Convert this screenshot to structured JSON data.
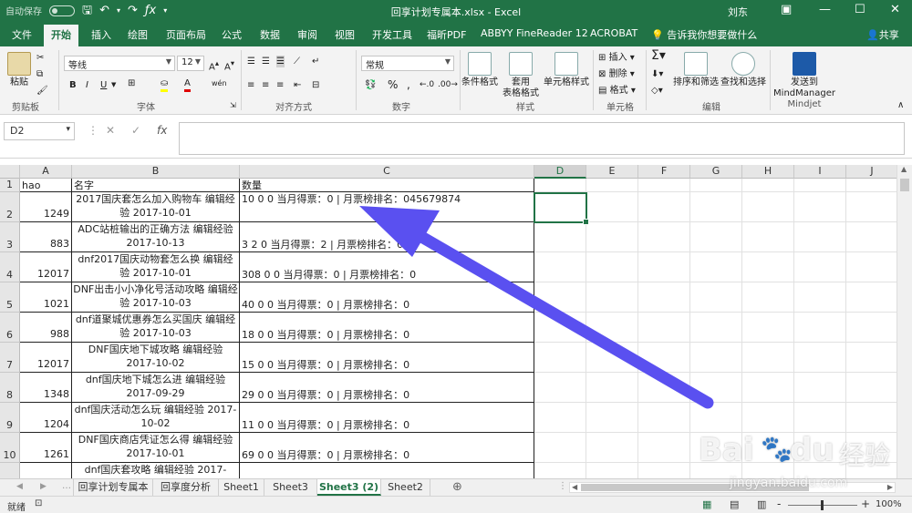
{
  "window": {
    "title": "回享计划专属本.xlsx - Excel",
    "autosave_label": "自动保存",
    "autosave_state": "关",
    "user": "刘东",
    "share_label": "共享"
  },
  "tabs": [
    "文件",
    "开始",
    "插入",
    "绘图",
    "页面布局",
    "公式",
    "数据",
    "审阅",
    "视图",
    "开发工具",
    "福昕PDF",
    "ABBYY FineReader 12",
    "ACROBAT"
  ],
  "active_tab": "开始",
  "tell_me": "告诉我你想要做什么",
  "ribbon": {
    "paste_label": "粘贴",
    "clipboard_label": "剪贴板",
    "font_name": "等线",
    "font_size": "12",
    "font_label": "字体",
    "bold": "B",
    "italic": "I",
    "underline": "U",
    "wen": "wén",
    "align_label": "对齐方式",
    "number_format": "常规",
    "number_label": "数字",
    "percent": "%",
    "comma": ",",
    "cond_format": "条件格式",
    "table_format_1": "套用",
    "table_format_2": "表格格式",
    "cell_style": "单元格样式",
    "styles_label": "样式",
    "insert": "插入",
    "delete": "删除",
    "format": "格式",
    "cells_label": "单元格",
    "sort_filter": "排序和筛选",
    "find_select": "查找和选择",
    "editing_label": "编辑",
    "mindmanager_1": "发送到",
    "mindmanager_2": "MindManager",
    "mindjet_label": "Mindjet"
  },
  "name_box": "D2",
  "formula_bar": {
    "fx": "fx",
    "value": ""
  },
  "columns": [
    "A",
    "B",
    "C",
    "D",
    "E",
    "F",
    "G",
    "H",
    "I",
    "J"
  ],
  "selected_column": "D",
  "rows": [
    {
      "n": "1",
      "a": "hao",
      "b": "名字",
      "c": "数量"
    },
    {
      "n": "2",
      "a": "1249",
      "b": "2017国庆套怎么加入购物车 编辑经验 2017-10-01",
      "c": "10 0 0 当月得票：0 | 月票榜排名：045679874"
    },
    {
      "n": "3",
      "a": "883",
      "b": "ADC站桩输出的正确方法 编辑经验 2017-10-13",
      "c": "3 2 0 当月得票：2 | 月票榜排名：0"
    },
    {
      "n": "4",
      "a": "12017",
      "b": "dnf2017国庆动物套怎么换 编辑经验 2017-10-01",
      "c": "308 0 0 当月得票：0 | 月票榜排名：0"
    },
    {
      "n": "5",
      "a": "1021",
      "b": "DNF出击小小净化号活动攻略 编辑经验 2017-10-03",
      "c": "40 0 0 当月得票：0 | 月票榜排名：0"
    },
    {
      "n": "6",
      "a": "988",
      "b": "dnf道聚城优惠券怎么买国庆 编辑经验 2017-10-03",
      "c": "18 0 0 当月得票：0 | 月票榜排名：0"
    },
    {
      "n": "7",
      "a": "12017",
      "b": "DNF国庆地下城攻略 编辑经验 2017-10-02",
      "c": "15 0 0 当月得票：0 | 月票榜排名：0"
    },
    {
      "n": "8",
      "a": "1348",
      "b": "dnf国庆地下城怎么进 编辑经验 2017-09-29",
      "c": "29 0 0 当月得票：0 | 月票榜排名：0"
    },
    {
      "n": "9",
      "a": "1204",
      "b": "dnf国庆活动怎么玩 编辑经验 2017-10-02",
      "c": "11 0 0 当月得票：0 | 月票榜排名：0"
    },
    {
      "n": "10",
      "a": "1261",
      "b": "DNF国庆商店凭证怎么得 编辑经验 2017-10-01",
      "c": "69 0 0 当月得票：0 | 月票榜排名：0"
    },
    {
      "n": "",
      "a": "",
      "b": "dnf国庆套攻略 编辑经验 2017-",
      "c": ""
    }
  ],
  "sheets": [
    "回享计划专属本",
    "回享度分析",
    "Sheet1",
    "Sheet3",
    "Sheet3 (2)",
    "Sheet2"
  ],
  "active_sheet": "Sheet3 (2)",
  "status": {
    "ready": "就绪",
    "zoom": "100%",
    "minus": "-",
    "plus": "+"
  },
  "watermark": {
    "brand": "Bai",
    "paw": "du",
    "cn": "经验",
    "url": "jingyan.baidu.com"
  },
  "colors": {
    "excel_green": "#217346",
    "arrow": "#5a50f0"
  }
}
